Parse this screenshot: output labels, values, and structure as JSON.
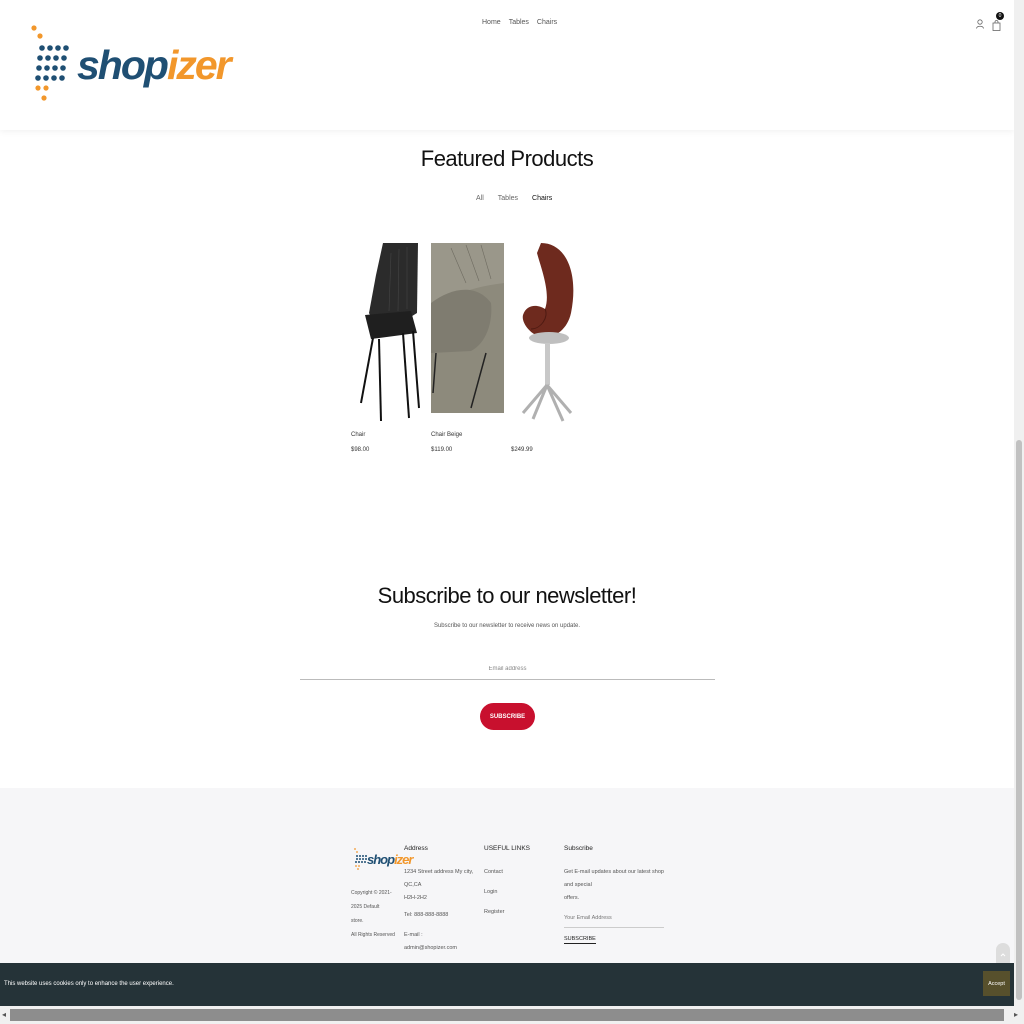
{
  "header": {
    "logo": {
      "part1": "shop",
      "part2": "izer"
    },
    "nav": [
      "Home",
      "Tables",
      "Chairs"
    ],
    "cart_count": "0",
    "icons": [
      "user-icon",
      "cart-icon"
    ]
  },
  "featured": {
    "title": "Featured Products",
    "tabs": [
      "All",
      "Tables",
      "Chairs"
    ],
    "active_tab": "Chairs",
    "products": [
      {
        "name": "Chair",
        "price": "$98.00"
      },
      {
        "name": "Chair Beige",
        "price": "$119.00"
      },
      {
        "name": "",
        "price": "$249.99"
      }
    ]
  },
  "newsletter": {
    "title": "Subscribe to our newsletter!",
    "subtitle": "Subscribe to our newsletter to receive news on update.",
    "placeholder": "Email address",
    "button": "SUBSCRIBE"
  },
  "footer": {
    "logo": {
      "part1": "shop",
      "part2": "izer"
    },
    "copyright_lines": [
      "Copyright © 2021-2025 Default",
      "store.",
      "All Rights Reserved"
    ],
    "address": {
      "title": "Address",
      "line1": "1234 Street address My city, QC,CA",
      "line2": "H2H-2H2",
      "tel": "Tel: 888-888-8888",
      "email": "E-mail : admin@shopizer.com"
    },
    "links": {
      "title": "USEFUL LINKS",
      "items": [
        "Contact",
        "Login",
        "Register"
      ]
    },
    "subscribe": {
      "title": "Subscribe",
      "text_line1": "Get E-mail updates about our latest shop and special",
      "text_line2": "offers.",
      "placeholder": "Your Email Address",
      "button": "SUBSCRIBE"
    }
  },
  "cookie": {
    "text": "This website uses cookies only to enhance the user experience.",
    "accept": "Accept"
  },
  "colors": {
    "brand_blue": "#1f4f73",
    "brand_orange": "#f2972b",
    "subscribe_red": "#c8102e",
    "cookie_bg": "#253338"
  }
}
